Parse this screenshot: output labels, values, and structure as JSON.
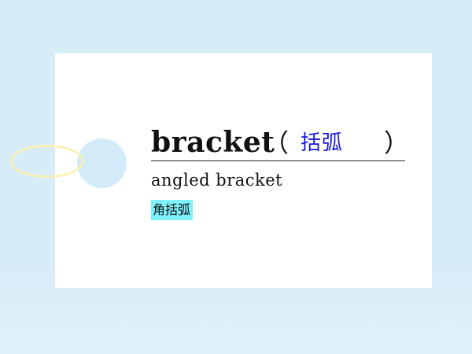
{
  "card": {
    "word": "bracket",
    "paren_open": "（",
    "translation": "括弧",
    "paren_close": "）",
    "example": "angled bracket",
    "example_translation": "角括弧"
  },
  "colors": {
    "background": "#d6ecf7",
    "card": "#ffffff",
    "translation_text": "#1a1ad8",
    "highlight": "#7ff1fb",
    "string": "#f8f2b6"
  }
}
